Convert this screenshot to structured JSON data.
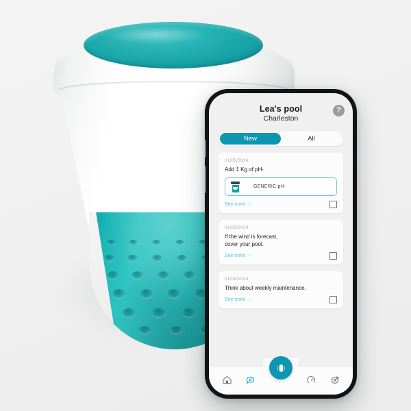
{
  "scene": {
    "background_color": "#f1f1f1",
    "product": {
      "name": "pool-monitor-device",
      "body_color": "#ffffff",
      "accent_color": "#26bdbb",
      "top_disc_color": "#1ea9ab"
    }
  },
  "app": {
    "accent_color": "#0c96b2",
    "link_color": "#4cc3dd",
    "screen_background": "#f0f0f0",
    "card_background": "#fcfcfc",
    "header": {
      "title": "Lea's pool",
      "subtitle": "Charleston",
      "help_label": "?",
      "help_icon": "question-mark-icon"
    },
    "segmented": {
      "options": [
        {
          "label": "New",
          "active": true
        },
        {
          "label": "All",
          "active": false
        }
      ]
    },
    "cards": [
      {
        "date": "01/05/2024",
        "text": "Add 1 Kg of pH-",
        "product": {
          "label": "GENERIC pH-",
          "icon": "chemical-bucket-icon"
        },
        "see_more_label": "See more",
        "chevron": "›",
        "checked": false
      },
      {
        "date": "01/05/2024",
        "text": "If the wind is forecast,\ncover your pool.",
        "see_more_label": "See more",
        "chevron": "›",
        "checked": false
      },
      {
        "date": "01/05/2024",
        "text": "Think about weekly maintenance.",
        "see_more_label": "See more",
        "chevron": "›",
        "checked": false
      }
    ],
    "bottom_nav": {
      "items": [
        {
          "icon": "home-icon",
          "active": false
        },
        {
          "icon": "chat-bubble-icon",
          "active": true
        },
        {
          "icon": "gauge-icon",
          "active": false
        },
        {
          "icon": "pool-cleaner-icon",
          "active": false
        }
      ],
      "fab": {
        "icon": "device-pod-icon",
        "color": "#0c96b2"
      }
    }
  }
}
